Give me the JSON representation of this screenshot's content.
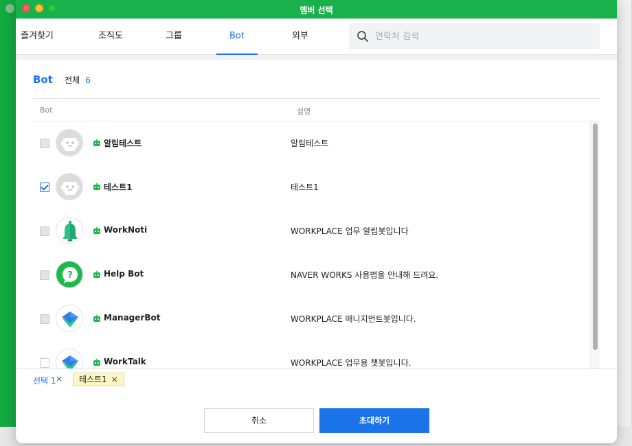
{
  "window": {
    "title": "멤버 선택"
  },
  "tabs": [
    {
      "label": "즐겨찾기"
    },
    {
      "label": "조직도"
    },
    {
      "label": "그룹"
    },
    {
      "label": "Bot"
    },
    {
      "label": "외부"
    }
  ],
  "active_tab": "Bot",
  "search": {
    "placeholder": "연락처 검색",
    "value": ""
  },
  "section": {
    "title": "Bot",
    "total_label": "전체",
    "count": "6"
  },
  "columns": {
    "bot": "Bot",
    "description": "설명"
  },
  "bots": [
    {
      "name": "알림테스트",
      "description": "알림테스트",
      "checked": false,
      "avatar": "robot-icon"
    },
    {
      "name": "테스트1",
      "description": "테스트1",
      "checked": true,
      "avatar": "robot-icon"
    },
    {
      "name": "WorkNoti",
      "description": "WORKPLACE 업무 알림봇입니다",
      "checked": false,
      "avatar": "bell-icon"
    },
    {
      "name": "Help Bot",
      "description": "NAVER WORKS 사용법을 안내해 드려요.",
      "checked": false,
      "avatar": "help-bubble-icon"
    },
    {
      "name": "ManagerBot",
      "description": "WORKPLACE 매니지먼트봇입니다.",
      "checked": false,
      "avatar": "layers-icon"
    },
    {
      "name": "WorkTalk",
      "description": "WORKPLACE 업무용 챗봇입니다.",
      "checked": false,
      "avatar": "layers-icon"
    }
  ],
  "selection": {
    "label": "선택",
    "count": "1",
    "clear": "×",
    "chips": [
      {
        "label": "테스트1",
        "remove": "×"
      }
    ]
  },
  "buttons": {
    "cancel": "취소",
    "invite": "초대하기"
  },
  "colors": {
    "accent": "#1a73e8",
    "titlebar": "#19b14b",
    "bot_badge": "#1fb84c",
    "chip_bg": "#fff6c5"
  }
}
